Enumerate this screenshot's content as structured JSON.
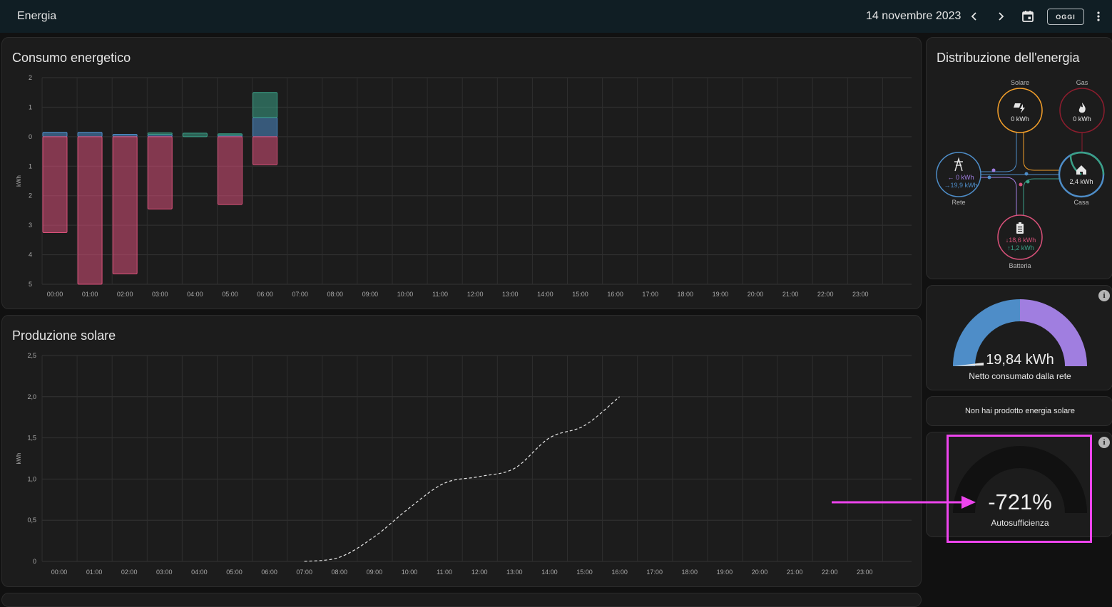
{
  "header": {
    "title": "Energia",
    "date": "14 novembre 2023",
    "today_label": "OGGI"
  },
  "consumption_card": {
    "title": "Consumo energetico"
  },
  "solar_card": {
    "title": "Produzione solare"
  },
  "distribution_card": {
    "title": "Distribuzione dell'energia",
    "solar": {
      "label": "Solare",
      "value": "0 kWh"
    },
    "gas": {
      "label": "Gas",
      "value": "0 kWh"
    },
    "grid": {
      "label": "Rete",
      "in": "0 kWh",
      "out": "19,9 kWh"
    },
    "home": {
      "label": "Casa",
      "value": "2,4 kWh"
    },
    "battery": {
      "label": "Batteria",
      "in": "18,6 kWh",
      "out": "1,2 kWh"
    }
  },
  "grid_gauge": {
    "value": "19,84 kWh",
    "label": "Netto consumato dalla rete"
  },
  "no_solar": {
    "text": "Non hai prodotto energia solare"
  },
  "self_sufficiency": {
    "value": "-721%",
    "label": "Autosufficienza"
  },
  "colors": {
    "battery_in": "#d9517a",
    "battery_out": "#3aa087",
    "grid": "#4e8dc8",
    "solar": "#f5a02a",
    "gas": "#8e1d2e",
    "grid_return": "#a07ee0",
    "highlight": "#ee44ee"
  },
  "chart_data": [
    {
      "type": "bar",
      "title": "Consumo energetico",
      "ylabel": "kWh",
      "categories": [
        "00:00",
        "01:00",
        "02:00",
        "03:00",
        "04:00",
        "05:00",
        "06:00",
        "07:00",
        "08:00",
        "09:00",
        "10:00",
        "11:00",
        "12:00",
        "13:00",
        "14:00",
        "15:00",
        "16:00",
        "17:00",
        "18:00",
        "19:00",
        "20:00",
        "21:00",
        "22:00",
        "23:00"
      ],
      "yticks_pos": [
        "2",
        "1",
        "0"
      ],
      "yticks_neg": [
        "1",
        "2",
        "3",
        "4",
        "5"
      ],
      "ylim": [
        -5,
        2
      ],
      "series": [
        {
          "key": "grid",
          "values": [
            0.15,
            0.15,
            0.08,
            0.08,
            0,
            0.05,
            0.65,
            0,
            0,
            0,
            0,
            0,
            0,
            0,
            0,
            0,
            0,
            0,
            0,
            0,
            0,
            0,
            0,
            0
          ]
        },
        {
          "key": "battery_out",
          "values": [
            0,
            0,
            0,
            0.05,
            0.12,
            0.05,
            0.85,
            0,
            0,
            0,
            0,
            0,
            0,
            0,
            0,
            0,
            0,
            0,
            0,
            0,
            0,
            0,
            0,
            0
          ]
        },
        {
          "key": "battery_in",
          "values": [
            -3.25,
            -5,
            -4.65,
            -2.45,
            0,
            -2.3,
            -0.95,
            0,
            0,
            0,
            0,
            0,
            0,
            0,
            0,
            0,
            0,
            0,
            0,
            0,
            0,
            0,
            0,
            0
          ]
        }
      ]
    },
    {
      "type": "line",
      "title": "Produzione solare",
      "ylabel": "kWh",
      "categories": [
        "00:00",
        "01:00",
        "02:00",
        "03:00",
        "04:00",
        "05:00",
        "06:00",
        "07:00",
        "08:00",
        "09:00",
        "10:00",
        "11:00",
        "12:00",
        "13:00",
        "14:00",
        "15:00",
        "16:00",
        "17:00",
        "18:00",
        "19:00",
        "20:00",
        "21:00",
        "22:00",
        "23:00"
      ],
      "yticks": [
        "0",
        "0,5",
        "1,0",
        "1,5",
        "2,0",
        "2,5"
      ],
      "ylim": [
        0,
        2.5
      ],
      "x": [
        7,
        8,
        9,
        10,
        11,
        12,
        13,
        14,
        15,
        16
      ],
      "y": [
        0,
        0.05,
        0.3,
        0.65,
        0.95,
        1.03,
        1.13,
        1.5,
        1.65,
        2.0
      ],
      "style": "dashed"
    }
  ]
}
